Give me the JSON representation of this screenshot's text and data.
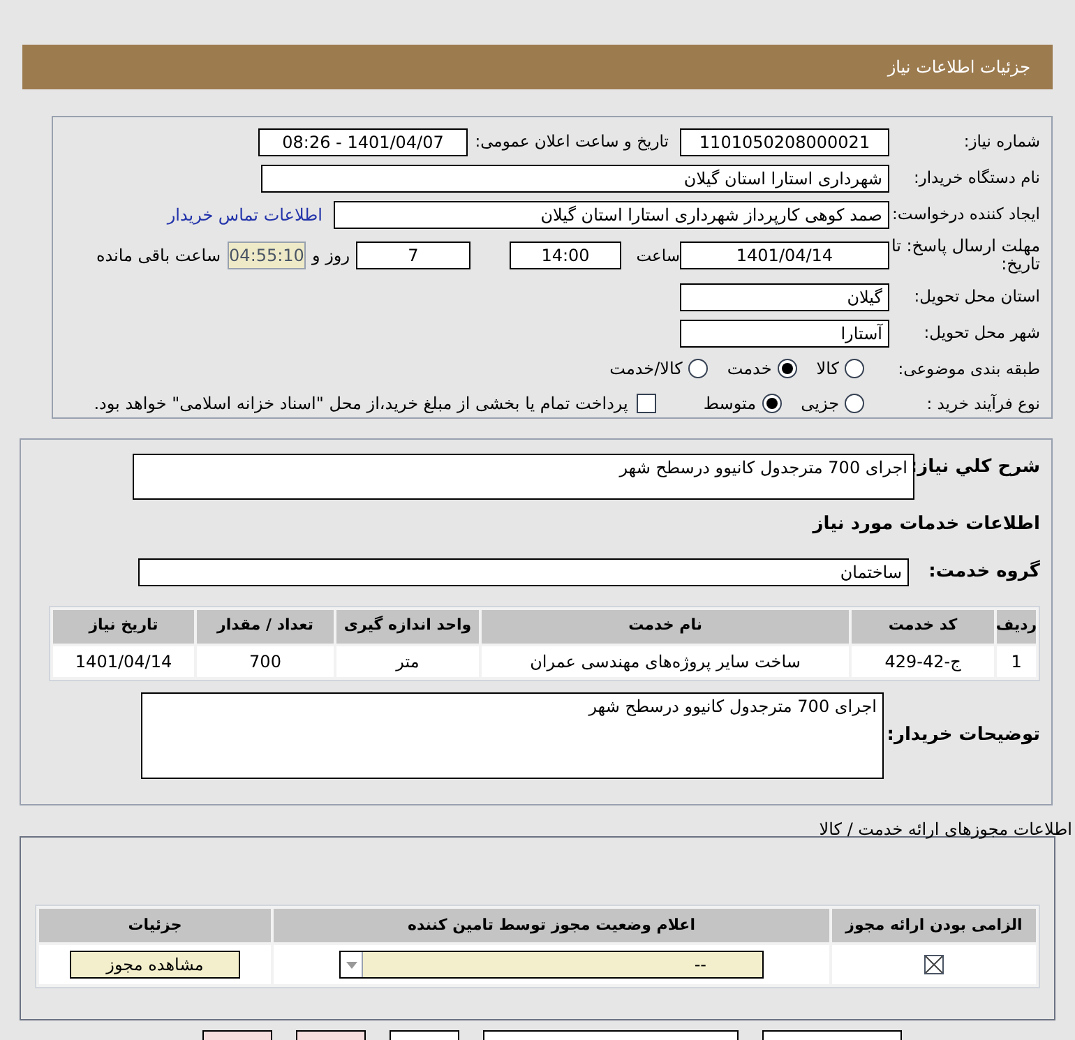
{
  "header": {
    "title": "جزئیات اطلاعات نیاز"
  },
  "details": {
    "need_number": {
      "label": "شماره نیاز:",
      "value": "1101050208000021"
    },
    "announce": {
      "label": "تاریخ و ساعت اعلان عمومی:",
      "value": "1401/04/07 - 08:26"
    },
    "buyer": {
      "label": "نام دستگاه خریدار:",
      "value": "شهرداری استارا استان گیلان"
    },
    "creator": {
      "label": "ایجاد کننده درخواست:",
      "value": "صمد کوهی کارپرداز شهرداری استارا استان گیلان",
      "link": "اطلاعات تماس خریدار"
    },
    "deadline": {
      "label": "مهلت ارسال پاسخ: تا تاریخ:",
      "date": "1401/04/14",
      "time_label": "ساعت",
      "time": "14:00",
      "days": "7",
      "days_label": "روز و",
      "remaining": "04:55:10",
      "remaining_label": "ساعت باقی مانده"
    },
    "province": {
      "label": "استان محل تحویل:",
      "value": "گیلان"
    },
    "city": {
      "label": "شهر محل تحویل:",
      "value": "آستارا"
    },
    "category": {
      "label": "طبقه بندی موضوعی:",
      "options": [
        {
          "label": "کالا",
          "selected": false
        },
        {
          "label": "خدمت",
          "selected": true
        },
        {
          "label": "کالا/خدمت",
          "selected": false
        }
      ]
    },
    "process": {
      "label": "نوع فرآیند خرید :",
      "options": [
        {
          "label": "جزیی",
          "selected": false
        },
        {
          "label": "متوسط",
          "selected": true
        }
      ],
      "payment": {
        "label": "پرداخت تمام یا بخشی از مبلغ خرید،از محل \"اسناد خزانه اسلامی\" خواهد بود.",
        "checked": false
      }
    }
  },
  "services": {
    "summary": {
      "label": "شرح کلي نیاز:",
      "value": "اجرای 700 مترجدول کانیوو درسطح شهر"
    },
    "section_title": "اطلاعات خدمات مورد نیاز",
    "group": {
      "label": "گروه خدمت:",
      "value": "ساختمان"
    },
    "table": {
      "columns": [
        "ردیف",
        "کد خدمت",
        "نام خدمت",
        "واحد اندازه گیری",
        "تعداد / مقدار",
        "تاریخ نیاز"
      ],
      "rows": [
        [
          "1",
          "ج-42-429",
          "ساخت سایر پروژه‌های مهندسی عمران",
          "متر",
          "700",
          "1401/04/14"
        ]
      ]
    },
    "notes": {
      "label": "توضیحات خریدار:",
      "value": "اجرای 700 مترجدول کانیوو درسطح شهر"
    }
  },
  "permits": {
    "title": "اطلاعات مجوزهای ارائه خدمت / کالا",
    "columns": [
      "الزامی بودن ارائه مجوز",
      "اعلام وضعیت مجوز توسط تامین کننده",
      "جزئیات"
    ],
    "rows": [
      {
        "required": true,
        "status": "--",
        "button": "مشاهده مجوز"
      }
    ]
  }
}
